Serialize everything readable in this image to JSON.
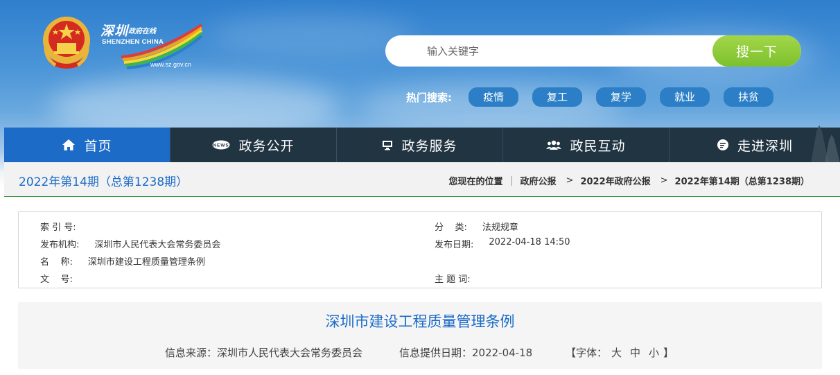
{
  "header": {
    "site_chars": "深圳",
    "site_online": "政府在线",
    "site_en": "SHENZHEN  CHINA",
    "site_url": "www.sz.gov.cn"
  },
  "search": {
    "placeholder": "输入关键字",
    "button_label": "搜一下"
  },
  "hot_search": {
    "label": "热门搜索:",
    "tags": [
      "疫情",
      "复工",
      "复学",
      "就业",
      "扶贫"
    ]
  },
  "nav": {
    "items": [
      {
        "label": "首页",
        "icon": "home-icon"
      },
      {
        "label": "政务公开",
        "icon": "news-icon"
      },
      {
        "label": "政务服务",
        "icon": "monitor-icon"
      },
      {
        "label": "政民互动",
        "icon": "people-icon"
      },
      {
        "label": "走进深圳",
        "icon": "chat-icon"
      }
    ],
    "active_color": "#1b6bc7",
    "bar_color": "#213442"
  },
  "breadcrumb": {
    "issue_title": "2022年第14期（总第1238期）",
    "location_label": "您现在的位置",
    "items": [
      "政府公报",
      "2022年政府公报",
      "2022年第14期（总第1238期）"
    ]
  },
  "meta": {
    "index_label": "索 引 号:",
    "index_value": "",
    "publisher_label": "发布机构:",
    "publisher_value": "深圳市人民代表大会常务委员会",
    "name_label": "名    称:",
    "name_value": "深圳市建设工程质量管理条例",
    "docno_label": "文    号:",
    "docno_value": "",
    "category_label": "分    类:",
    "category_value": "法规规章",
    "date_label": "发布日期:",
    "date_value": "2022-04-18 14:50",
    "keywords_label": "主 题 词:",
    "keywords_value": ""
  },
  "article": {
    "title": "深圳市建设工程质量管理条例",
    "source": "信息来源：深圳市人民代表大会常务委员会",
    "provided_date": "信息提供日期：2022-04-18",
    "font_label": "【字体：",
    "font_options": [
      "大",
      "中",
      "小"
    ],
    "font_close": "】"
  }
}
